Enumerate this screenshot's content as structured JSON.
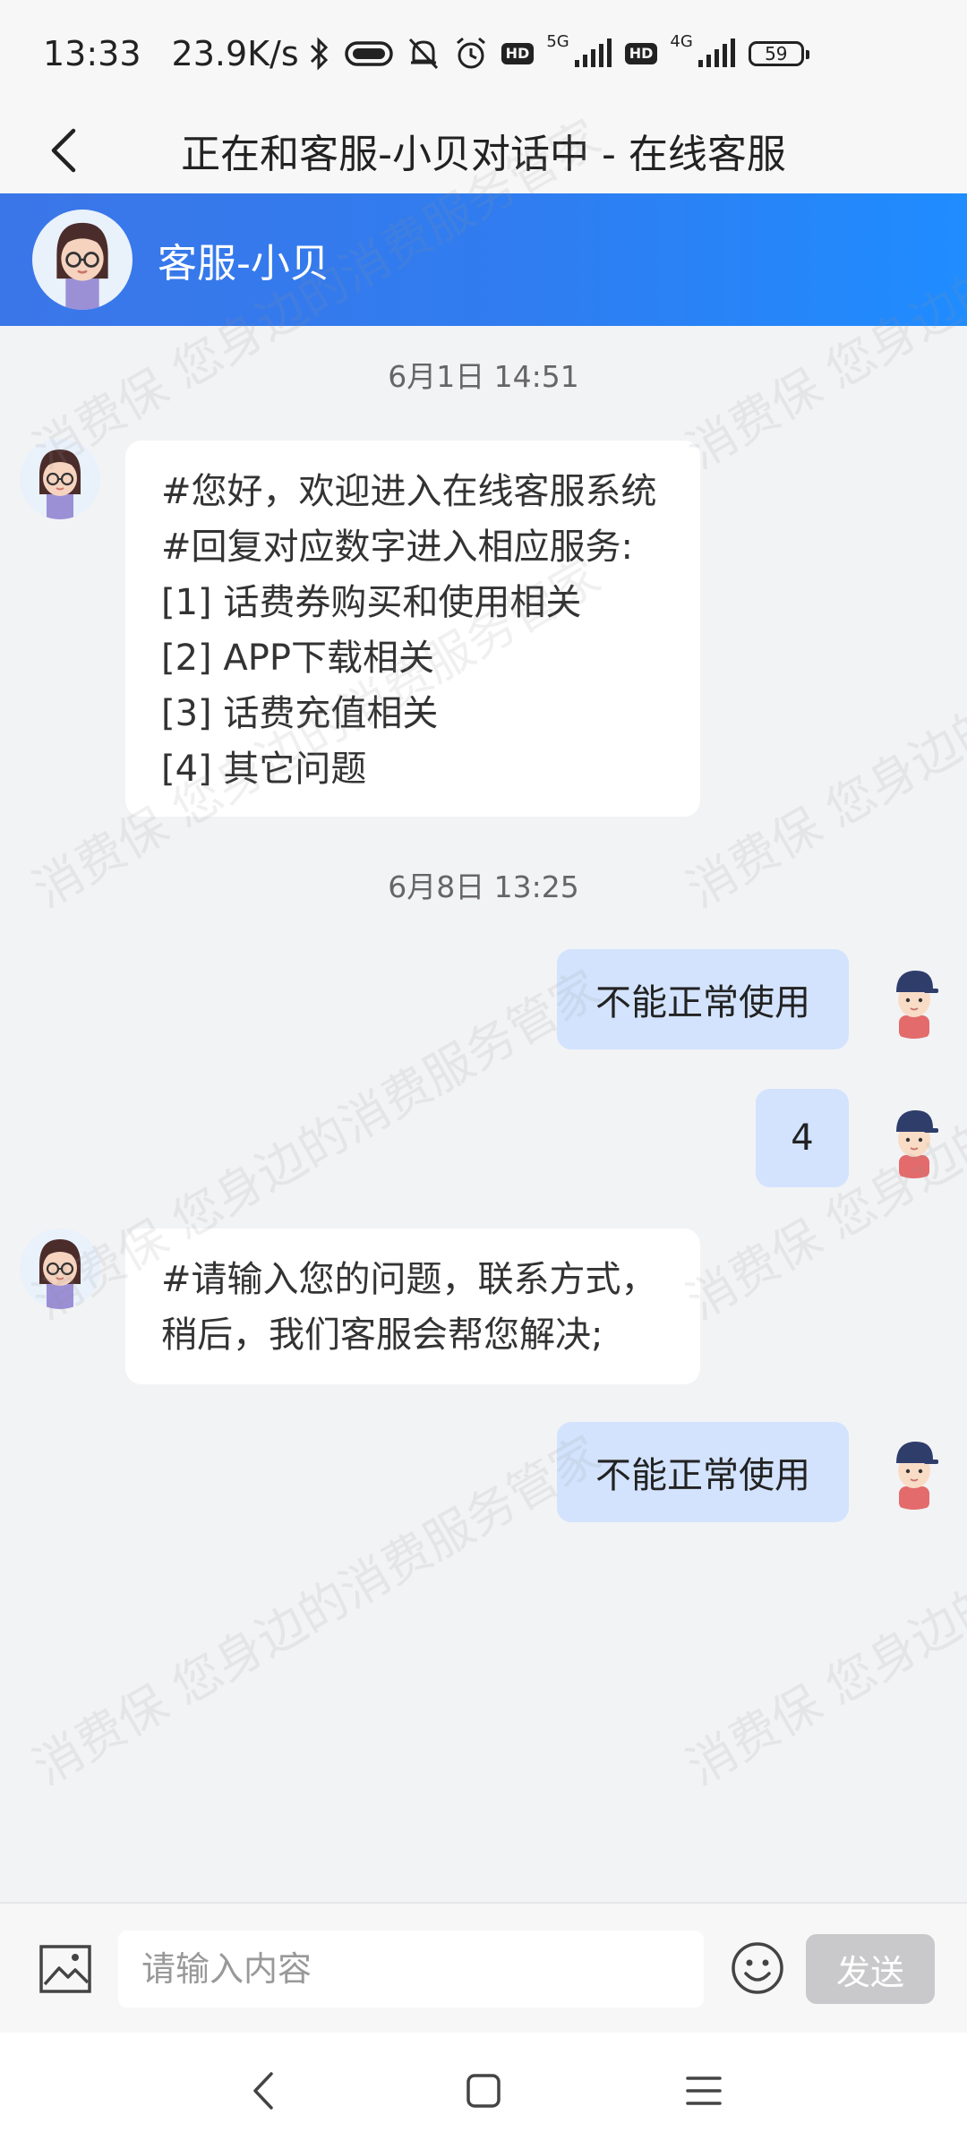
{
  "status_bar": {
    "time": "13:33",
    "speed": "23.9K/s",
    "hd": "HD",
    "net1": "5G",
    "net2": "4G",
    "battery": "59"
  },
  "title_bar": {
    "title": "正在和客服-小贝对话中 - 在线客服"
  },
  "agent": {
    "name": "客服-小贝"
  },
  "messages": {
    "ts1": "6月1日 14:51",
    "greeting": {
      "line1": "#您好，欢迎进入在线客服系统",
      "line2": "#回复对应数字进入相应服务:",
      "line3": "[1] 话费券购买和使用相关",
      "line4": "[2] APP下载相关",
      "line5": "[3] 话费充值相关",
      "line6": "[4] 其它问题"
    },
    "ts2": "6月8日 13:25",
    "user1": "不能正常使用",
    "user2": "4",
    "prompt": {
      "line1": "#请输入您的问题，联系方式，",
      "line2": "稍后，我们客服会帮您解决;"
    },
    "user3": "不能正常使用"
  },
  "input_bar": {
    "placeholder": "请输入内容",
    "send_label": "发送"
  },
  "watermark": {
    "text1": "消费保 您身边的消费服务管家",
    "text2": "消费保 您身边的消费服务管家",
    "text3": "消费保 您身边的消费服务管家",
    "text4": "消费保 您身边的消费服务管家",
    "text5": "消费保 您身边的消费服务管家",
    "text6": "消费保 您身边的消费服务管家",
    "text7": "消费保 您身边的消费服务管家",
    "text8": "消费保 您身边的消费服务管家"
  },
  "colors": {
    "header_gradient_start": "#3b76e8",
    "header_gradient_end": "#1f8cff",
    "user_bubble": "#d3e3fd",
    "send_button": "#c9c9cb"
  }
}
